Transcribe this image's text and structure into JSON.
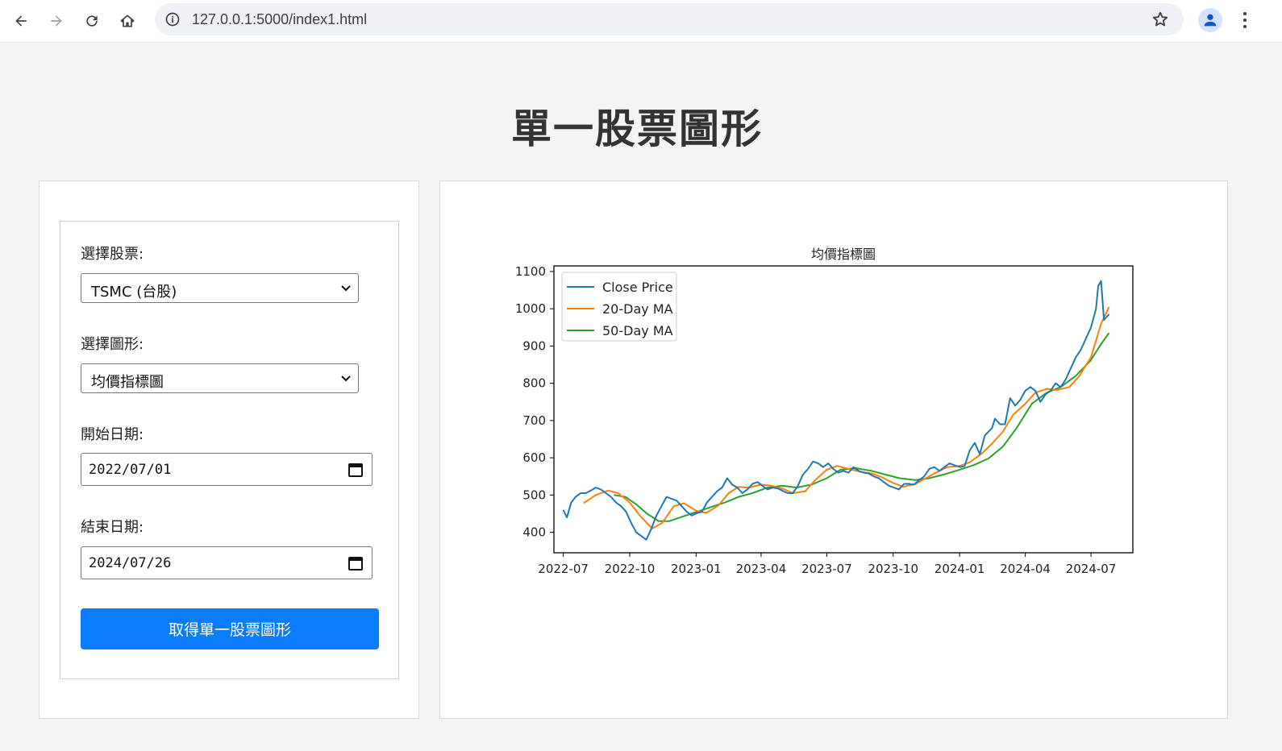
{
  "browser": {
    "url": "127.0.0.1:5000/index1.html",
    "icons": [
      "back-icon",
      "forward-icon",
      "reload-icon",
      "home-icon",
      "info-icon",
      "star-icon",
      "profile-icon",
      "menu-icon"
    ]
  },
  "page": {
    "title": "單一股票圖形"
  },
  "form": {
    "stock_label": "選擇股票:",
    "stock_value": "TSMC (台股)",
    "chart_label": "選擇圖形:",
    "chart_value": "均價指標圖",
    "start_label": "開始日期:",
    "start_value": "2022/07/01",
    "end_label": "結束日期:",
    "end_value": "2024/07/26",
    "submit_label": "取得單一股票圖形",
    "accent": "#0a7cff"
  },
  "chart_data": {
    "type": "line",
    "title": "均價指標圖",
    "xlabel": "",
    "ylabel": "",
    "x_ticks": [
      "2022-07",
      "2022-10",
      "2023-01",
      "2023-04",
      "2023-07",
      "2023-10",
      "2024-01",
      "2024-04",
      "2024-07"
    ],
    "y_ticks": [
      400,
      500,
      600,
      700,
      800,
      900,
      1000,
      1100
    ],
    "ylim": [
      345,
      1115
    ],
    "xlim": [
      "2022-06-18",
      "2024-08-28"
    ],
    "grid": false,
    "legend": "top-left",
    "series": [
      {
        "name": "Close Price",
        "color": "#1f77b4",
        "x": [
          "2022-07-01",
          "2022-07-06",
          "2022-07-12",
          "2022-07-18",
          "2022-07-25",
          "2022-08-01",
          "2022-08-08",
          "2022-08-15",
          "2022-08-22",
          "2022-08-29",
          "2022-09-05",
          "2022-09-12",
          "2022-09-19",
          "2022-09-26",
          "2022-10-03",
          "2022-10-10",
          "2022-10-17",
          "2022-10-24",
          "2022-10-31",
          "2022-11-07",
          "2022-11-14",
          "2022-11-21",
          "2022-11-28",
          "2022-12-05",
          "2022-12-12",
          "2022-12-19",
          "2022-12-26",
          "2023-01-03",
          "2023-01-09",
          "2023-01-16",
          "2023-01-30",
          "2023-02-06",
          "2023-02-13",
          "2023-02-20",
          "2023-02-27",
          "2023-03-06",
          "2023-03-13",
          "2023-03-20",
          "2023-03-27",
          "2023-04-06",
          "2023-04-10",
          "2023-04-17",
          "2023-04-24",
          "2023-05-02",
          "2023-05-08",
          "2023-05-15",
          "2023-05-22",
          "2023-05-29",
          "2023-06-05",
          "2023-06-12",
          "2023-06-19",
          "2023-06-26",
          "2023-07-03",
          "2023-07-10",
          "2023-07-17",
          "2023-07-24",
          "2023-07-31",
          "2023-08-07",
          "2023-08-14",
          "2023-08-21",
          "2023-08-28",
          "2023-09-04",
          "2023-09-11",
          "2023-09-18",
          "2023-09-25",
          "2023-10-02",
          "2023-10-09",
          "2023-10-16",
          "2023-10-23",
          "2023-10-30",
          "2023-11-06",
          "2023-11-13",
          "2023-11-20",
          "2023-11-27",
          "2023-12-04",
          "2023-12-11",
          "2023-12-18",
          "2023-12-25",
          "2024-01-02",
          "2024-01-08",
          "2024-01-15",
          "2024-01-22",
          "2024-01-29",
          "2024-02-05",
          "2024-02-15",
          "2024-02-19",
          "2024-02-26",
          "2024-03-04",
          "2024-03-11",
          "2024-03-18",
          "2024-03-25",
          "2024-04-01",
          "2024-04-08",
          "2024-04-15",
          "2024-04-22",
          "2024-04-29",
          "2024-05-06",
          "2024-05-13",
          "2024-05-20",
          "2024-05-27",
          "2024-06-03",
          "2024-06-10",
          "2024-06-17",
          "2024-06-24",
          "2024-07-01",
          "2024-07-08",
          "2024-07-11",
          "2024-07-15",
          "2024-07-19",
          "2024-07-26"
        ],
        "values": [
          460,
          440,
          480,
          495,
          505,
          505,
          512,
          520,
          515,
          505,
          495,
          480,
          470,
          455,
          425,
          400,
          390,
          380,
          410,
          445,
          470,
          495,
          490,
          485,
          470,
          455,
          445,
          452,
          455,
          480,
          510,
          520,
          545,
          528,
          520,
          505,
          515,
          530,
          535,
          520,
          515,
          520,
          518,
          510,
          505,
          505,
          525,
          555,
          570,
          590,
          585,
          575,
          585,
          570,
          560,
          565,
          560,
          575,
          565,
          560,
          558,
          550,
          545,
          535,
          525,
          520,
          515,
          530,
          530,
          528,
          540,
          550,
          570,
          575,
          565,
          575,
          585,
          580,
          575,
          578,
          620,
          640,
          610,
          660,
          680,
          705,
          690,
          690,
          760,
          740,
          755,
          780,
          790,
          780,
          750,
          770,
          780,
          800,
          790,
          810,
          840,
          870,
          890,
          920,
          950,
          1000,
          1060,
          1075,
          970,
          985
        ]
      },
      {
        "name": "20-Day MA",
        "color": "#ff7f0e",
        "x": [
          "2022-07-29",
          "2022-08-15",
          "2022-09-01",
          "2022-09-15",
          "2022-10-01",
          "2022-10-15",
          "2022-11-01",
          "2022-11-15",
          "2022-12-01",
          "2022-12-15",
          "2023-01-01",
          "2023-01-15",
          "2023-02-01",
          "2023-02-15",
          "2023-03-01",
          "2023-03-15",
          "2023-04-01",
          "2023-04-15",
          "2023-05-01",
          "2023-05-15",
          "2023-06-01",
          "2023-06-15",
          "2023-07-01",
          "2023-07-15",
          "2023-08-01",
          "2023-08-15",
          "2023-09-01",
          "2023-09-15",
          "2023-10-01",
          "2023-10-15",
          "2023-11-01",
          "2023-11-15",
          "2023-12-01",
          "2023-12-15",
          "2024-01-01",
          "2024-01-15",
          "2024-02-01",
          "2024-02-15",
          "2024-03-01",
          "2024-03-15",
          "2024-04-01",
          "2024-04-15",
          "2024-05-01",
          "2024-05-15",
          "2024-06-01",
          "2024-06-15",
          "2024-07-01",
          "2024-07-15",
          "2024-07-26"
        ],
        "values": [
          478,
          500,
          512,
          505,
          480,
          445,
          410,
          425,
          470,
          478,
          458,
          452,
          472,
          505,
          522,
          520,
          528,
          525,
          517,
          505,
          510,
          540,
          568,
          578,
          570,
          563,
          558,
          548,
          532,
          522,
          530,
          545,
          562,
          575,
          578,
          588,
          612,
          638,
          670,
          715,
          745,
          775,
          785,
          782,
          790,
          820,
          870,
          960,
          1005
        ]
      },
      {
        "name": "50-Day MA",
        "color": "#2ca02c",
        "x": [
          "2022-09-09",
          "2022-09-25",
          "2022-10-10",
          "2022-10-25",
          "2022-11-10",
          "2022-11-25",
          "2022-12-10",
          "2022-12-25",
          "2023-01-10",
          "2023-01-25",
          "2023-02-10",
          "2023-03-01",
          "2023-03-20",
          "2023-04-10",
          "2023-05-01",
          "2023-05-20",
          "2023-06-10",
          "2023-07-01",
          "2023-07-20",
          "2023-08-10",
          "2023-09-01",
          "2023-09-20",
          "2023-10-10",
          "2023-11-01",
          "2023-11-20",
          "2023-12-10",
          "2024-01-01",
          "2024-01-20",
          "2024-02-10",
          "2024-03-01",
          "2024-03-20",
          "2024-04-10",
          "2024-05-01",
          "2024-05-20",
          "2024-06-10",
          "2024-06-30",
          "2024-07-15",
          "2024-07-26"
        ],
        "values": [
          500,
          495,
          475,
          450,
          430,
          430,
          440,
          450,
          460,
          470,
          480,
          495,
          505,
          520,
          525,
          520,
          528,
          545,
          568,
          572,
          565,
          555,
          545,
          540,
          545,
          555,
          568,
          580,
          598,
          630,
          680,
          745,
          775,
          790,
          820,
          860,
          905,
          935
        ]
      }
    ]
  }
}
